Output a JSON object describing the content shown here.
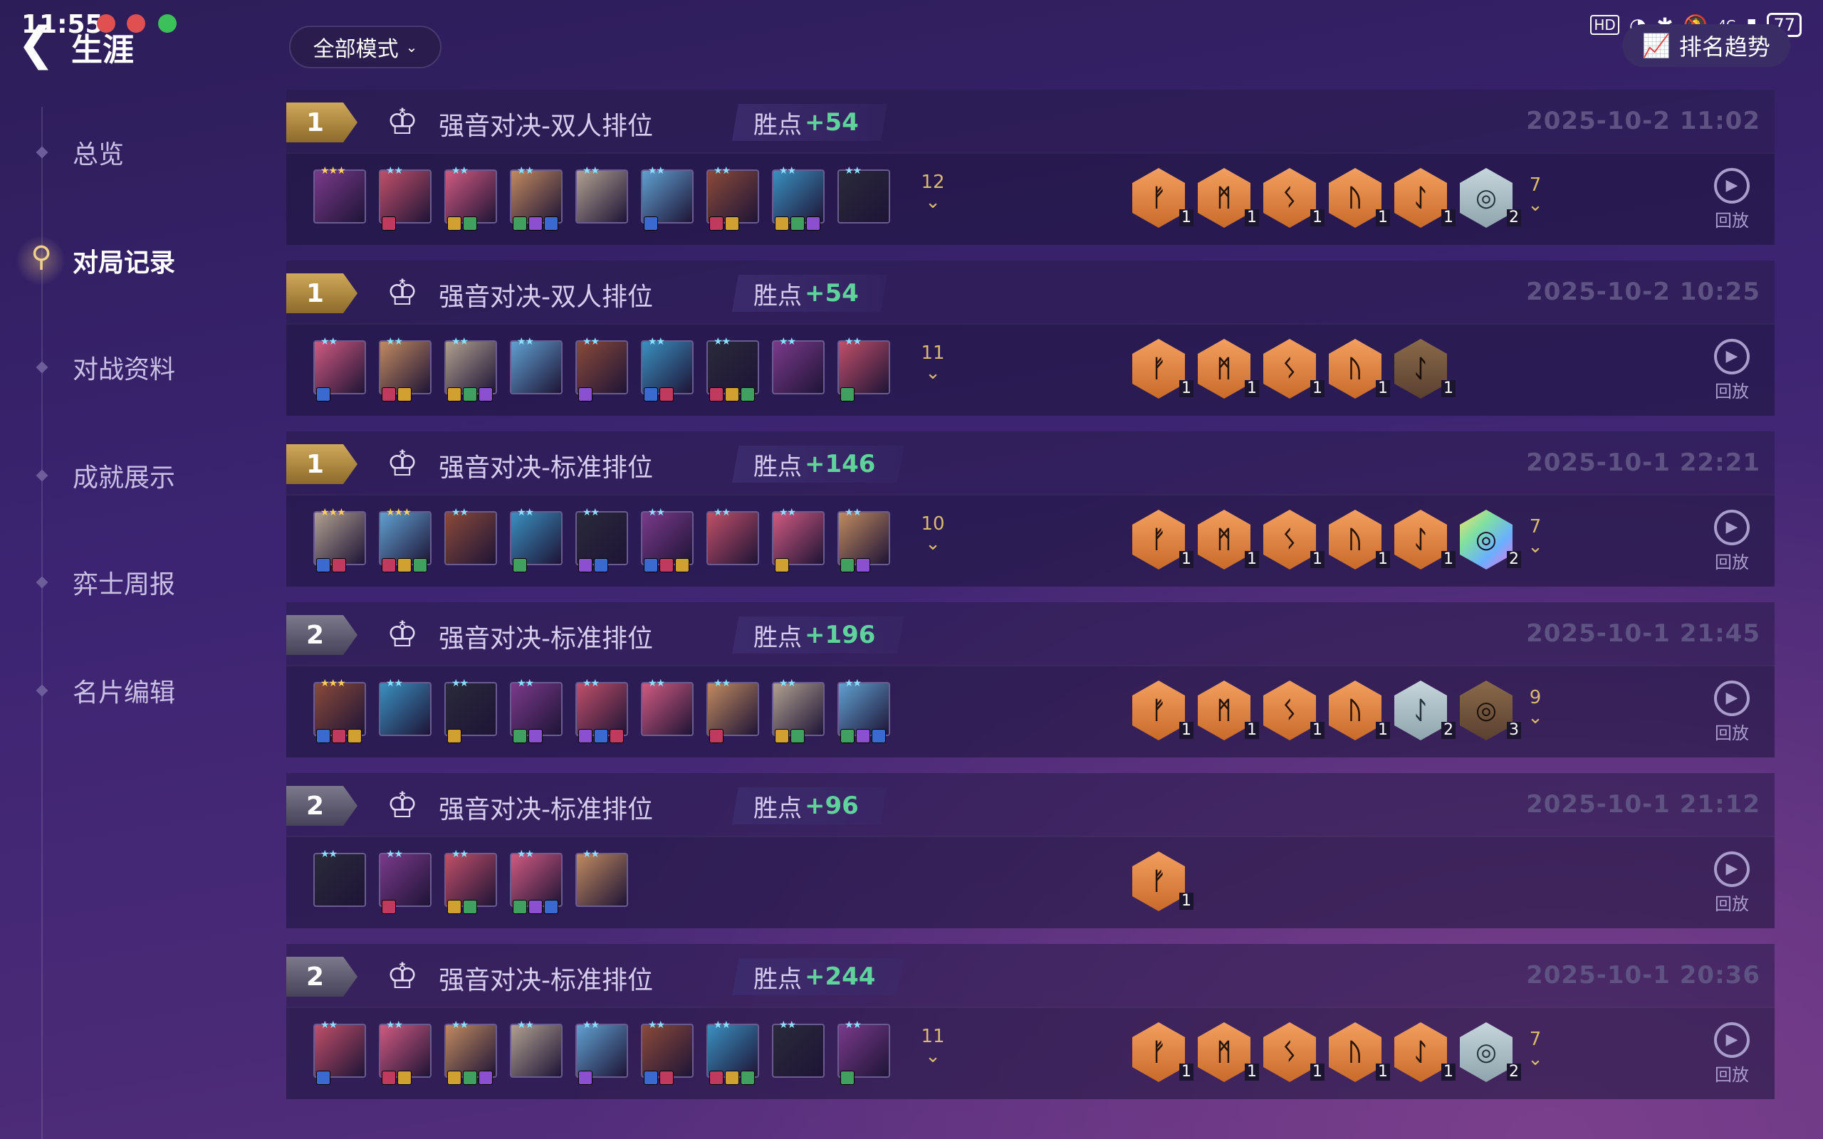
{
  "status_bar": {
    "time": "11:55",
    "battery": "77",
    "network": "4G",
    "hd": "HD"
  },
  "header": {
    "back_icon": "back-arrow-icon",
    "title": "生涯",
    "mode_select": "全部模式",
    "trend_button": "排名趋势"
  },
  "sidebar": {
    "items": [
      {
        "label": "总览",
        "active": false
      },
      {
        "label": "对局记录",
        "active": true
      },
      {
        "label": "对战资料",
        "active": false
      },
      {
        "label": "成就展示",
        "active": false
      },
      {
        "label": "弈士周报",
        "active": false
      },
      {
        "label": "名片编辑",
        "active": false
      }
    ]
  },
  "matches": [
    {
      "rank": "1",
      "mode": "强音对决-双人排位",
      "lp_label": "胜点",
      "lp_value": "+54",
      "time": "2025-10-2  11:02",
      "champ_extra": "12",
      "trait_extra": "7",
      "replay": "回放",
      "traits": [
        [
          "bronze",
          "1"
        ],
        [
          "bronze",
          "1"
        ],
        [
          "bronze",
          "1"
        ],
        [
          "bronze",
          "1"
        ],
        [
          "bronze",
          "1"
        ],
        [
          "silver",
          "2"
        ]
      ]
    },
    {
      "rank": "1",
      "mode": "强音对决-双人排位",
      "lp_label": "胜点",
      "lp_value": "+54",
      "time": "2025-10-2  10:25",
      "champ_extra": "11",
      "trait_extra": "",
      "replay": "回放",
      "traits": [
        [
          "bronze",
          "1"
        ],
        [
          "bronze",
          "1"
        ],
        [
          "bronze",
          "1"
        ],
        [
          "bronze",
          "1"
        ],
        [
          "dark",
          "1"
        ]
      ]
    },
    {
      "rank": "1",
      "mode": "强音对决-标准排位",
      "lp_label": "胜点",
      "lp_value": "+146",
      "time": "2025-10-1  22:21",
      "champ_extra": "10",
      "trait_extra": "7",
      "replay": "回放",
      "traits": [
        [
          "bronze",
          "1"
        ],
        [
          "bronze",
          "1"
        ],
        [
          "bronze",
          "1"
        ],
        [
          "bronze",
          "1"
        ],
        [
          "bronze",
          "1"
        ],
        [
          "prism",
          "2"
        ]
      ]
    },
    {
      "rank": "2",
      "mode": "强音对决-标准排位",
      "lp_label": "胜点",
      "lp_value": "+196",
      "time": "2025-10-1  21:45",
      "champ_extra": "",
      "trait_extra": "9",
      "replay": "回放",
      "traits": [
        [
          "bronze",
          "1"
        ],
        [
          "bronze",
          "1"
        ],
        [
          "bronze",
          "1"
        ],
        [
          "bronze",
          "1"
        ],
        [
          "silver",
          "2"
        ],
        [
          "dark",
          "3"
        ]
      ]
    },
    {
      "rank": "2",
      "mode": "强音对决-标准排位",
      "lp_label": "胜点",
      "lp_value": "+96",
      "time": "2025-10-1  21:12",
      "champ_extra": "",
      "trait_extra": "",
      "replay": "回放",
      "traits": [
        [
          "bronze",
          "1"
        ]
      ]
    },
    {
      "rank": "2",
      "mode": "强音对决-标准排位",
      "lp_label": "胜点",
      "lp_value": "+244",
      "time": "2025-10-1  20:36",
      "champ_extra": "11",
      "trait_extra": "7",
      "replay": "回放",
      "traits": [
        [
          "bronze",
          "1"
        ],
        [
          "bronze",
          "1"
        ],
        [
          "bronze",
          "1"
        ],
        [
          "bronze",
          "1"
        ],
        [
          "bronze",
          "1"
        ],
        [
          "silver",
          "2"
        ]
      ]
    }
  ],
  "champ_counts": [
    9,
    9,
    9,
    9,
    5,
    9
  ],
  "colors": {
    "gold_rank": "#cfa95a",
    "silver_rank": "#7d7a8c",
    "lp_green": "#5fd39b",
    "trait_bronze": "#e88a48",
    "trait_silver": "#b4c6cc"
  }
}
